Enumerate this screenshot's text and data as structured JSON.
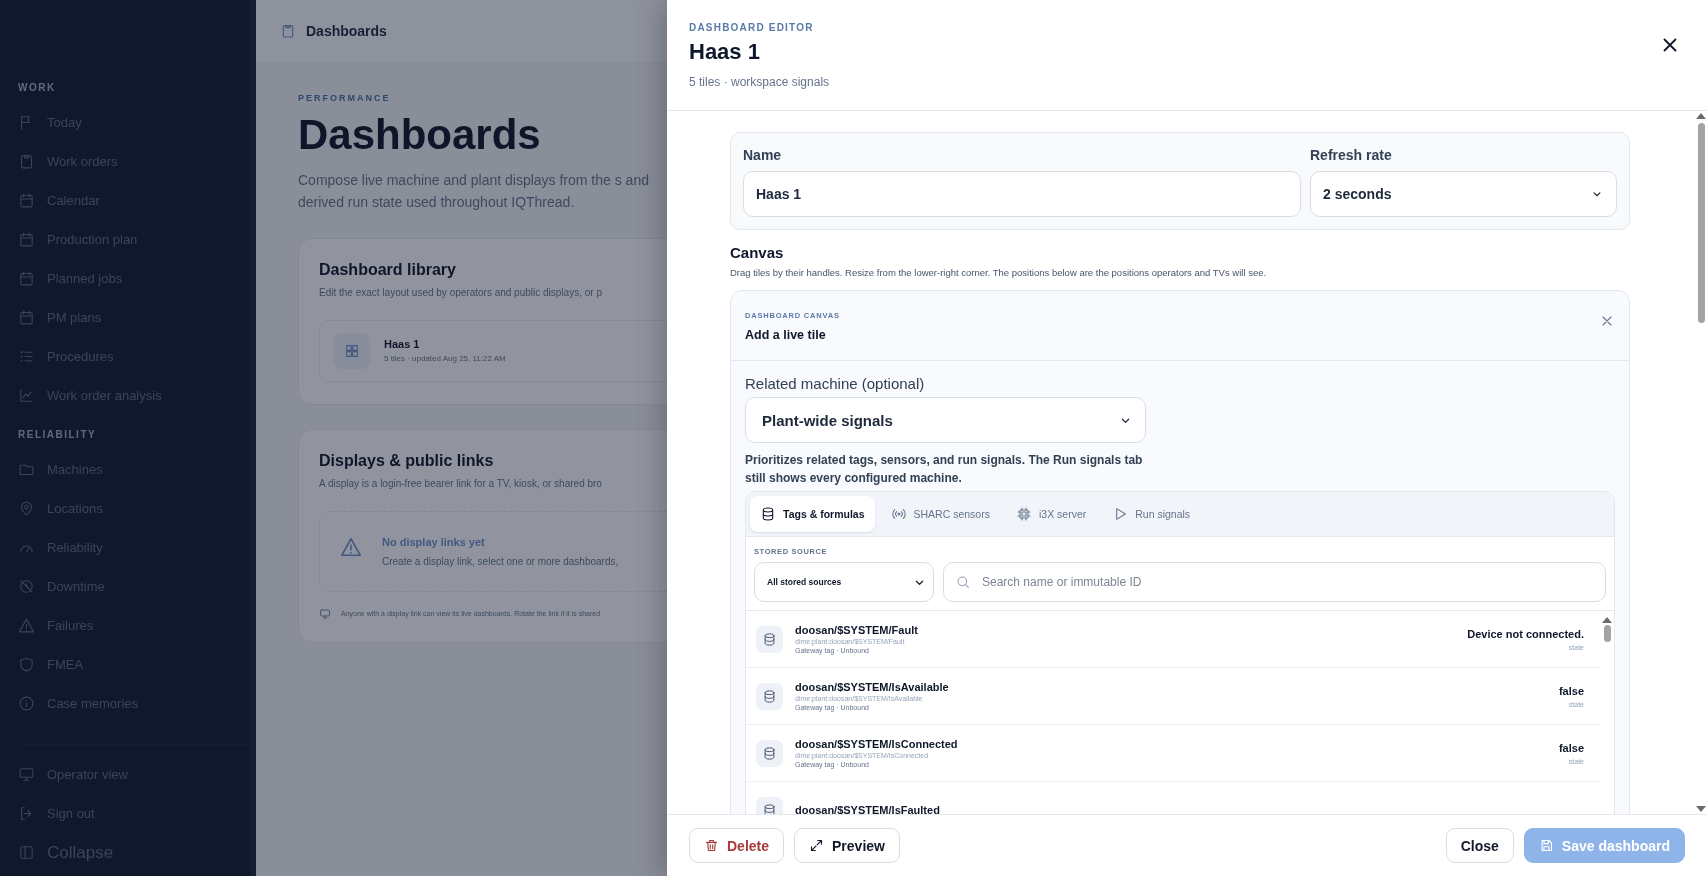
{
  "sidebar": {
    "sections": [
      {
        "heading": "WORK",
        "items": [
          {
            "label": "Today"
          },
          {
            "label": "Work orders"
          },
          {
            "label": "Calendar"
          },
          {
            "label": "Production plan"
          },
          {
            "label": "Planned jobs"
          },
          {
            "label": "PM plans"
          },
          {
            "label": "Procedures"
          },
          {
            "label": "Work order analysis"
          }
        ]
      },
      {
        "heading": "RELIABILITY",
        "items": [
          {
            "label": "Machines"
          },
          {
            "label": "Locations"
          },
          {
            "label": "Reliability"
          },
          {
            "label": "Downtime"
          },
          {
            "label": "Failures"
          },
          {
            "label": "FMEA"
          },
          {
            "label": "Case memories"
          }
        ]
      }
    ],
    "footer_items": [
      {
        "label": "Operator view"
      },
      {
        "label": "Sign out"
      },
      {
        "label": "Collapse"
      }
    ]
  },
  "page": {
    "breadcrumb": "Dashboards",
    "eyebrow": "PERFORMANCE",
    "title": "Dashboards",
    "description": "Compose live machine and plant displays from the s and derived run state used throughout IQThread.",
    "library": {
      "title": "Dashboard library",
      "description": "Edit the exact layout used by operators and public displays, or p",
      "items": [
        {
          "name": "Haas 1",
          "meta": "5 tiles · updated Aug 25, 11:22 AM"
        }
      ]
    },
    "displays": {
      "title": "Displays & public links",
      "description": "A display is a login-free bearer link for a TV, kiosk, or shared bro",
      "empty_title": "No display links yet",
      "empty_text": "Create a display link, select one or more dashboards,",
      "note": "Anyone with a display link can view its live dashboards. Rotate the link if it is shared"
    }
  },
  "editor": {
    "eyebrow": "DASHBOARD EDITOR",
    "title": "Haas 1",
    "subtitle": "5 tiles · workspace signals",
    "form": {
      "name_label": "Name",
      "name_value": "Haas 1",
      "refresh_label": "Refresh rate",
      "refresh_value": "2 seconds"
    },
    "canvas": {
      "heading": "Canvas",
      "description": "Drag tiles by their handles. Resize from the lower-right corner. The positions below are the positions operators and TVs will see.",
      "panel": {
        "eyebrow": "DASHBOARD CANVAS",
        "title": "Add a live tile",
        "machine_label": "Related machine (optional)",
        "machine_value": "Plant-wide signals",
        "help": "Prioritizes related tags, sensors, and run signals. The Run signals tab still shows every configured machine.",
        "tabs": [
          {
            "label": "Tags & formulas",
            "selected": true
          },
          {
            "label": "SHARC sensors",
            "selected": false
          },
          {
            "label": "i3X server",
            "selected": false
          },
          {
            "label": "Run signals",
            "selected": false
          }
        ],
        "source_label": "STORED SOURCE",
        "source_value": "All stored sources",
        "search_placeholder": "Search name or immutable ID",
        "rows": [
          {
            "name": "doosan/$SYSTEM/Fault",
            "id": "dime:plant:doosan/$SYSTEM/Fault",
            "meta": "Gateway tag · Unbound",
            "value": "Device not connected.",
            "value_label": "state"
          },
          {
            "name": "doosan/$SYSTEM/IsAvailable",
            "id": "dime:plant:doosan/$SYSTEM/IsAvailable",
            "meta": "Gateway tag · Unbound",
            "value": "false",
            "value_label": "state"
          },
          {
            "name": "doosan/$SYSTEM/IsConnected",
            "id": "dime:plant:doosan/$SYSTEM/IsConnected",
            "meta": "Gateway tag · Unbound",
            "value": "false",
            "value_label": "state"
          },
          {
            "name": "doosan/$SYSTEM/IsFaulted"
          }
        ]
      }
    },
    "footer": {
      "delete": "Delete",
      "preview": "Preview",
      "close": "Close",
      "save": {
        "label": "Save dashboard",
        "disabled": true
      }
    }
  }
}
